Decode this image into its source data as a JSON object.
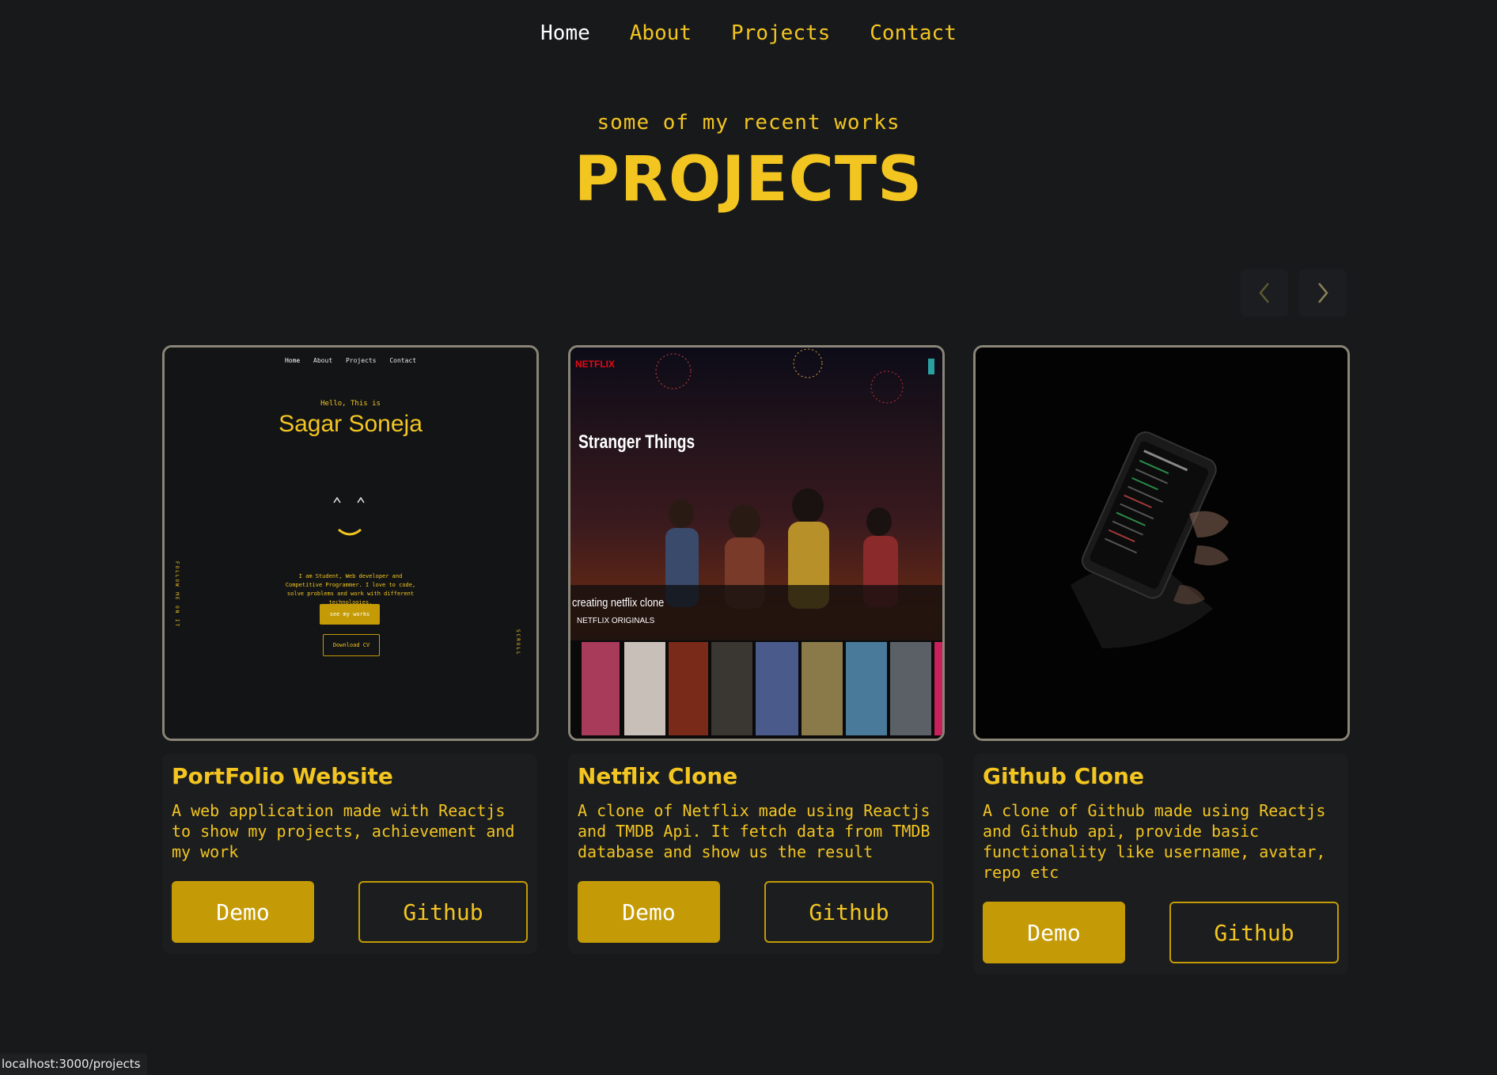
{
  "nav": {
    "items": [
      {
        "label": "Home"
      },
      {
        "label": "About"
      },
      {
        "label": "Projects"
      },
      {
        "label": "Contact"
      }
    ]
  },
  "header": {
    "subtitle": "some of my recent works",
    "title": "PROJECTS"
  },
  "carousel": {
    "prev_icon": "chevron-left-icon",
    "next_icon": "chevron-right-icon"
  },
  "projects": [
    {
      "title": "PortFolio Website",
      "description": "A web application made with Reactjs to show my projects, achievement and my work",
      "demo_label": "Demo",
      "github_label": "Github",
      "preview": {
        "nav": [
          "Home",
          "About",
          "Projects",
          "Contact"
        ],
        "hello": "Hello, This is",
        "name": "Sagar Soneja",
        "desc": "I am Student, Web developer and Competitive Programmer. I love to code, solve problems and work with different technologies.",
        "works_btn": "see my works",
        "cv_btn": "Download CV",
        "follow": "FOLLOW ME ON IT",
        "scroll": "SCROLL"
      }
    },
    {
      "title": "Netflix Clone",
      "description": "A clone of Netflix made using Reactjs and TMDB Api. It fetch data from TMDB database and show us the result",
      "demo_label": "Demo",
      "github_label": "Github",
      "preview": {
        "brand": "NETFLIX",
        "show": "Stranger Things",
        "row_title": "creating netflix clone",
        "row_sub": "NETFLIX ORIGINALS"
      }
    },
    {
      "title": "Github Clone",
      "description": "A clone of Github made using Reactjs and Github api, provide basic functionality like username, avatar, repo etc",
      "demo_label": "Demo",
      "github_label": "Github"
    }
  ],
  "status_bar": "localhost:3000/projects",
  "colors": {
    "background": "#18191b",
    "accent": "#f2c521",
    "button": "#c49b06"
  }
}
